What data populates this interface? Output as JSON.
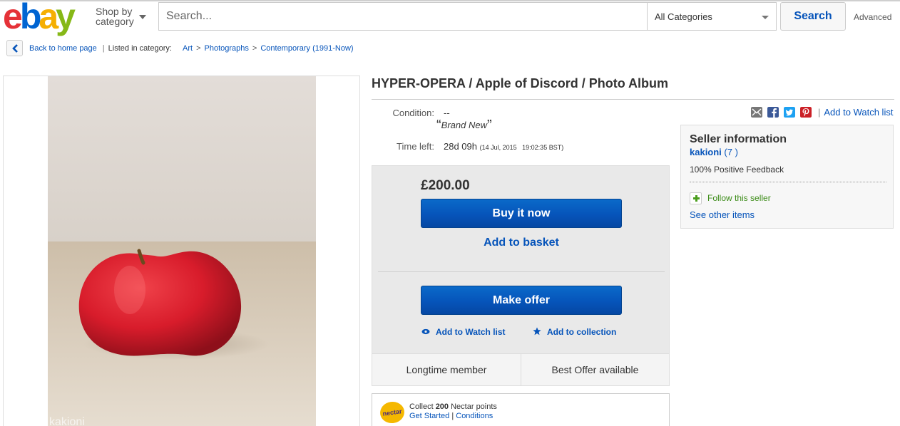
{
  "header": {
    "logo_letters": [
      {
        "ch": "e",
        "color": "#e53238"
      },
      {
        "ch": "b",
        "color": "#0064d2"
      },
      {
        "ch": "a",
        "color": "#f5af02"
      },
      {
        "ch": "y",
        "color": "#86b817"
      }
    ],
    "shop_by_line1": "Shop by",
    "shop_by_line2": "category",
    "search_placeholder": "Search...",
    "category_selected": "All Categories",
    "search_button": "Search",
    "advanced_link": "Advanced"
  },
  "breadcrumb": {
    "back_label": "Back to home page",
    "listed_in": "Listed in category:",
    "items": [
      "Art",
      "Photographs",
      "Contemporary (1991-Now)"
    ],
    "separator": ">"
  },
  "item": {
    "title": "HYPER-OPERA / Apple of Discord / Photo Album",
    "condition_label": "Condition:",
    "condition_value": "--",
    "condition_desc": "Brand New",
    "time_left_label": "Time left:",
    "time_left_value": "28d 09h",
    "time_left_end": "(14 Jul, 2015   19:02:35 BST)",
    "watermark": "kakioni"
  },
  "buybox": {
    "price": "£200.00",
    "buy_now": "Buy it now",
    "add_to_basket": "Add to basket",
    "make_offer": "Make offer",
    "add_watch": "Add to Watch list",
    "add_collection": "Add to collection",
    "footer_left": "Longtime member",
    "footer_right": "Best Offer available"
  },
  "nectar": {
    "logo": "nectar",
    "collect_prefix": "Collect",
    "points": "200",
    "collect_suffix": "Nectar points",
    "get_started": "Get Started",
    "conditions": "Conditions"
  },
  "share": {
    "icons": [
      {
        "name": "email-icon",
        "color": "#777777"
      },
      {
        "name": "facebook-icon",
        "color": "#3b5998"
      },
      {
        "name": "twitter-icon",
        "color": "#1da1f2"
      },
      {
        "name": "pinterest-icon",
        "color": "#cb2027"
      }
    ],
    "watch_link": "Add to Watch list"
  },
  "seller": {
    "heading": "Seller information",
    "name": "kakioni",
    "feedback_score": "(7 )",
    "positive": "100% Positive Feedback",
    "follow": "Follow this seller",
    "see_other": "See other items"
  }
}
